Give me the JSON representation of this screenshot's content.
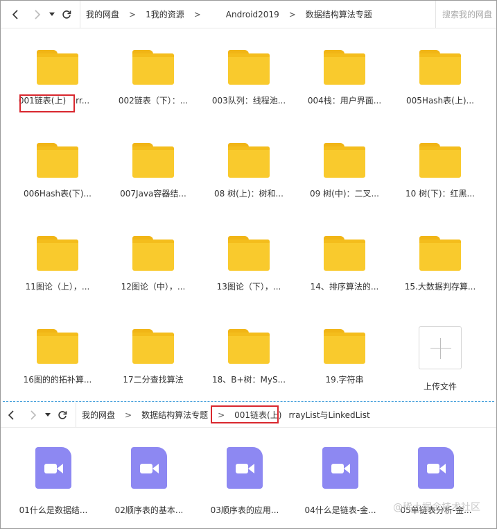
{
  "top_panel": {
    "breadcrumbs": [
      "我的网盘",
      "1我的资源",
      "Android2019",
      "数据结构算法专题"
    ],
    "separator": ">",
    "search_placeholder": "搜索我的网盘",
    "folders": [
      {
        "label": "001链表(上)"
      },
      {
        "label": "002链表（下）：..."
      },
      {
        "label": "003队列：线程池..."
      },
      {
        "label": "004栈：用户界面..."
      },
      {
        "label": "005Hash表(上)..."
      },
      {
        "label": "006Hash表(下)..."
      },
      {
        "label": "007Java容器结..."
      },
      {
        "label": "08 树(上)：树和..."
      },
      {
        "label": "09 树(中)：二叉..."
      },
      {
        "label": "10 树(下)：红黑..."
      },
      {
        "label": "11图论（上），..."
      },
      {
        "label": "12图论（中），..."
      },
      {
        "label": "13图论（下），..."
      },
      {
        "label": "14、排序算法的..."
      },
      {
        "label": "15.大数据判存算..."
      },
      {
        "label": "16图的的拓补算..."
      },
      {
        "label": "17二分查找算法"
      },
      {
        "label": "18、B+树：MyS..."
      },
      {
        "label": "19.字符串"
      }
    ],
    "first_folder_tail": "rr...",
    "upload_label": "上传文件"
  },
  "bottom_panel": {
    "breadcrumbs": [
      "我的网盘",
      "数据结构算法专题",
      "001链表(上)"
    ],
    "tail_text": "rrayList与LinkedList",
    "separator": ">",
    "videos": [
      {
        "label": "01什么是数据结..."
      },
      {
        "label": "02顺序表的基本..."
      },
      {
        "label": "03顺序表的应用..."
      },
      {
        "label": "04什么是链表-金..."
      },
      {
        "label": "05单链表分析-金..."
      }
    ]
  },
  "watermark": "@稀土掘金技术社区",
  "colors": {
    "folder": "#f9ca2d",
    "video": "#8d88f2",
    "highlight": "#d9272e",
    "divider": "#3a9ad9"
  },
  "icons": {
    "back": "chevron-left-icon",
    "forward": "chevron-right-icon",
    "dropdown": "caret-down-icon",
    "refresh": "refresh-icon",
    "upload": "plus-icon"
  }
}
